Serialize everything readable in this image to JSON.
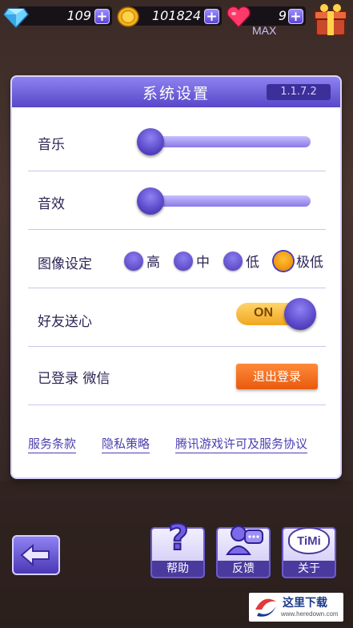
{
  "resources": {
    "gems": "109",
    "gold": "101824",
    "hearts": "9",
    "hearts_cap": "MAX",
    "plus_label": "+"
  },
  "settings": {
    "title": "系统设置",
    "version": "1.1.7.2",
    "music_label": "音乐",
    "music_level": 0.0,
    "sfx_label": "音效",
    "sfx_level": 0.0,
    "graphics_label": "图像设定",
    "graphics_options": [
      "高",
      "中",
      "低",
      "极低"
    ],
    "graphics_selected": "极低",
    "friend_hearts_label": "好友送心",
    "friend_hearts_toggle": "ON",
    "login_label": "已登录 微信",
    "logout_button": "退出登录",
    "links": [
      "服务条款",
      "隐私策略",
      "腾讯游戏许可及服务协议"
    ]
  },
  "bottom": {
    "help": "帮助",
    "feedback": "反馈",
    "about": "关于",
    "timi_logo": "TiMi"
  },
  "watermark": {
    "text": "这里下载",
    "url": "www.heredown.com"
  },
  "colors": {
    "accent_purple": "#5847c8",
    "selected_orange": "#f29b10",
    "logout_orange": "#e85a0e"
  }
}
